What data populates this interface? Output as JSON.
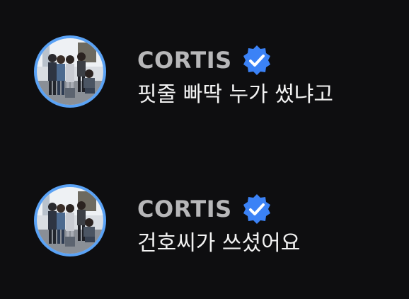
{
  "messages": [
    {
      "author": "CORTIS",
      "verified": true,
      "text": "핏줄 빠딱 누가 썼냐고"
    },
    {
      "author": "CORTIS",
      "verified": true,
      "text": "건호씨가 쓰셨어요"
    }
  ],
  "colors": {
    "background": "#0e0e10",
    "avatar_ring": "#5aa2f5",
    "verified_badge": "#3b82f6",
    "author_name": "#b7b7b9",
    "message_text": "#f2f2f2"
  },
  "icons": {
    "avatar": "group-photo-avatar",
    "verified": "verified-badge-icon"
  }
}
